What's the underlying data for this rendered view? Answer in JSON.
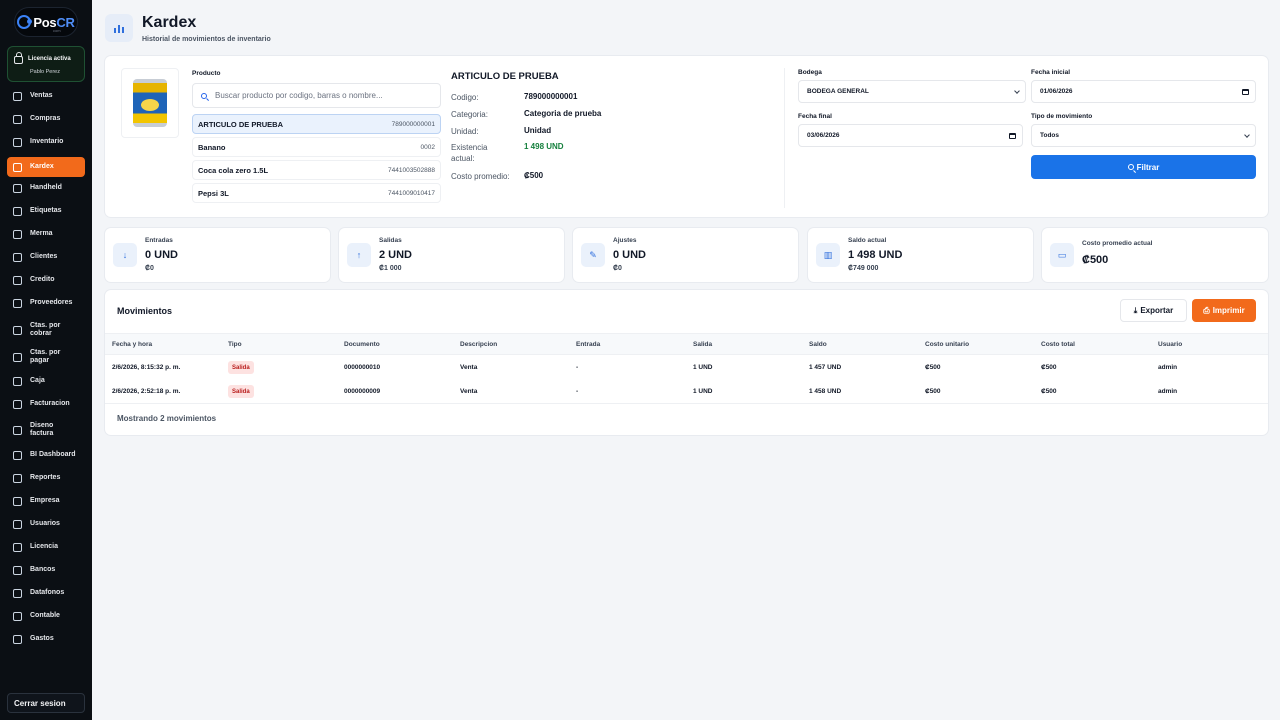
{
  "brand": {
    "name_a": "Pos",
    "name_b": "CR",
    "sub": "com"
  },
  "license": {
    "title": "Licencia activa",
    "user": "Pablo Perez"
  },
  "nav": [
    {
      "label": "Ventas",
      "icon": "cart-icon"
    },
    {
      "label": "Compras",
      "icon": "receipt-icon"
    },
    {
      "label": "Inventario",
      "icon": "box-icon"
    },
    {
      "label": "Kardex",
      "icon": "chart-icon"
    },
    {
      "label": "Handheld",
      "icon": "scanner-icon"
    },
    {
      "label": "Etiquetas",
      "icon": "tag-icon"
    },
    {
      "label": "Merma",
      "icon": "trash-icon"
    },
    {
      "label": "Clientes",
      "icon": "user-icon"
    },
    {
      "label": "Credito",
      "icon": "credit-icon"
    },
    {
      "label": "Proveedores",
      "icon": "truck-icon"
    },
    {
      "label": "Ctas. por cobrar",
      "icon": "download-icon"
    },
    {
      "label": "Ctas. por pagar",
      "icon": "upload-icon"
    },
    {
      "label": "Caja",
      "icon": "cash-icon"
    },
    {
      "label": "Facturacion",
      "icon": "document-icon"
    },
    {
      "label": "Diseno factura",
      "icon": "pencil-icon"
    },
    {
      "label": "BI Dashboard",
      "icon": "pie-icon"
    },
    {
      "label": "Reportes",
      "icon": "bar-icon"
    },
    {
      "label": "Empresa",
      "icon": "gear-icon"
    },
    {
      "label": "Usuarios",
      "icon": "users-icon"
    },
    {
      "label": "Licencia",
      "icon": "lock-icon"
    },
    {
      "label": "Bancos",
      "icon": "bank-icon"
    },
    {
      "label": "Datafonos",
      "icon": "terminal-icon"
    },
    {
      "label": "Contable",
      "icon": "calc-icon"
    },
    {
      "label": "Gastos",
      "icon": "wallet-icon"
    }
  ],
  "active_nav": "Kardex",
  "logout_label": "Cerrar sesion",
  "header": {
    "title": "Kardex",
    "subtitle": "Historial de movimientos de inventario"
  },
  "product": {
    "label": "Producto",
    "search_placeholder": "Buscar producto por codigo, barras o nombre...",
    "list": [
      {
        "name": "ARTICULO DE PRUEBA",
        "code": "789000000001",
        "selected": true
      },
      {
        "name": "Banano",
        "code": "0002"
      },
      {
        "name": "Coca cola zero 1.5L",
        "code": "7441003502888"
      },
      {
        "name": "Pepsi 3L",
        "code": "7441009010417"
      }
    ]
  },
  "detail": {
    "title": "ARTICULO DE PRUEBA",
    "rows": [
      {
        "key": "Codigo:",
        "value": "789000000001"
      },
      {
        "key": "Categoria:",
        "value": "Categoria de prueba"
      },
      {
        "key": "Unidad:",
        "value": "Unidad"
      },
      {
        "key": "Existencia actual:",
        "value": "1 498 UND",
        "color": "#15803d"
      },
      {
        "key": "Costo promedio:",
        "value": "₡500"
      }
    ]
  },
  "filters": {
    "bodega_label": "Bodega",
    "bodega_value": "BODEGA GENERAL",
    "fecha_inicial_label": "Fecha inicial",
    "fecha_inicial_value": "01/06/2026",
    "fecha_final_label": "Fecha final",
    "fecha_final_value": "03/06/2026",
    "tipo_label": "Tipo de movimiento",
    "tipo_value": "Todos",
    "filter_button": "Filtrar"
  },
  "stats": [
    {
      "label": "Entradas",
      "value": "0 UND",
      "sub": "₡0",
      "icon": "arrow-down-icon"
    },
    {
      "label": "Salidas",
      "value": "2 UND",
      "sub": "₡1 000",
      "icon": "arrow-up-icon"
    },
    {
      "label": "Ajustes",
      "value": "0 UND",
      "sub": "₡0",
      "icon": "pencil-icon"
    },
    {
      "label": "Saldo actual",
      "value": "1 498 UND",
      "sub": "₡749 000",
      "icon": "chart-icon"
    },
    {
      "label": "Costo promedio actual",
      "value": "₡500",
      "sub": "",
      "icon": "cash-icon"
    }
  ],
  "movements": {
    "title": "Movimientos",
    "export_label": "Exportar",
    "print_label": "Imprimir",
    "columns": [
      "Fecha y hora",
      "Tipo",
      "Documento",
      "Descripcion",
      "Entrada",
      "Salida",
      "Saldo",
      "Costo unitario",
      "Costo total",
      "Usuario"
    ],
    "rows": [
      [
        "2/6/2026, 8:15:32 p. m.",
        "Salida",
        "0000000010",
        "Venta",
        "-",
        "1 UND",
        "1 457 UND",
        "₡500",
        "₡500",
        "admin"
      ],
      [
        "2/6/2026, 2:52:18 p. m.",
        "Salida",
        "0000000009",
        "Venta",
        "-",
        "1 UND",
        "1 458 UND",
        "₡500",
        "₡500",
        "admin"
      ]
    ],
    "footer": "Mostrando 2 movimientos"
  },
  "colors": {
    "accent": "#f26a1b",
    "primary": "#1a73e8",
    "sidebar": "#0b0f14",
    "success": "#15803d"
  }
}
